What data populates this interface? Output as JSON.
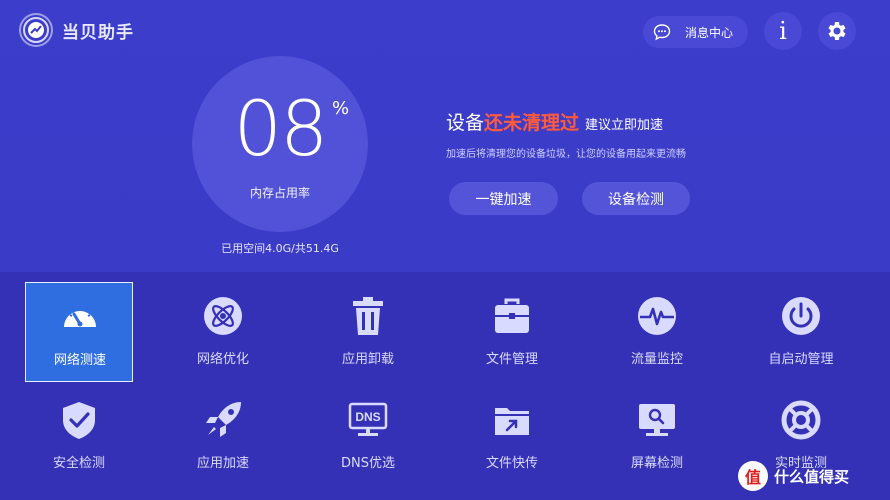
{
  "header": {
    "app_title": "当贝助手",
    "message_center_label": "消息中心",
    "info_label": "i"
  },
  "memory": {
    "percent": "08",
    "percent_symbol": "%",
    "label": "内存占用率",
    "storage_prefix": "已用空间",
    "storage_used": "4.0G",
    "storage_sep": "/共",
    "storage_total": "51.4G"
  },
  "status": {
    "prefix": "设备",
    "highlight": "还未清理过",
    "suffix": "建议立即加速",
    "description": "加速后将清理您的设备垃圾，让您的设备用起来更流畅",
    "highlight_color": "#ff5a3c"
  },
  "actions": {
    "boost_label": "一键加速",
    "check_label": "设备检测"
  },
  "tools": [
    {
      "label": "网络测速",
      "icon": "speedometer-icon",
      "active": true
    },
    {
      "label": "网络优化",
      "icon": "atom-icon"
    },
    {
      "label": "应用卸载",
      "icon": "trash-icon"
    },
    {
      "label": "文件管理",
      "icon": "toolbox-icon"
    },
    {
      "label": "流量监控",
      "icon": "pulse-icon"
    },
    {
      "label": "自启动管理",
      "icon": "power-icon"
    },
    {
      "label": "安全检测",
      "icon": "shield-check-icon"
    },
    {
      "label": "应用加速",
      "icon": "rocket-icon"
    },
    {
      "label": "DNS优选",
      "icon": "dns-icon"
    },
    {
      "label": "文件快传",
      "icon": "folder-send-icon"
    },
    {
      "label": "屏幕检测",
      "icon": "monitor-search-icon"
    },
    {
      "label": "实时监测",
      "icon": "lifebuoy-icon"
    }
  ],
  "watermark": {
    "badge": "值",
    "text": "什么值得买"
  },
  "colors": {
    "background_top": "#3c3dcb",
    "background_bottom": "#3531b6",
    "active_tile": "#2f6ee0"
  }
}
